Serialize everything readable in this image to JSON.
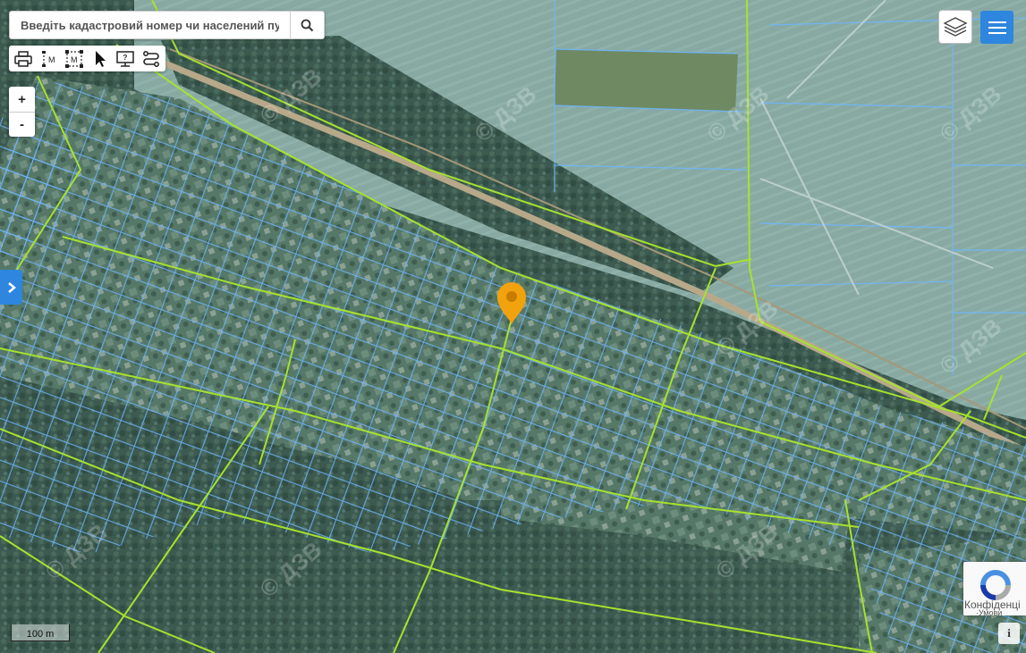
{
  "search": {
    "placeholder": "Введіть кадастровий номер чи населений пункт"
  },
  "toolbar": {
    "tools": [
      {
        "name": "print-icon"
      },
      {
        "name": "measure-distance-icon",
        "glyph": "M"
      },
      {
        "name": "measure-area-icon",
        "glyph": "M"
      },
      {
        "name": "cursor-icon"
      },
      {
        "name": "monitor-help-icon"
      },
      {
        "name": "route-icon"
      }
    ]
  },
  "zoom": {
    "in_label": "+",
    "out_label": "-"
  },
  "scale": {
    "label": "100 m"
  },
  "info": {
    "label": "i"
  },
  "recaptcha": {
    "label": "Конфіденці",
    "sub": "·Умови"
  },
  "map": {
    "watermark": "© ДЗВ",
    "marker_color": "#f2a20c",
    "parcel_color": "#6fb5ff",
    "boundary_color": "#a6e22e",
    "accent_color": "#2e86de"
  }
}
